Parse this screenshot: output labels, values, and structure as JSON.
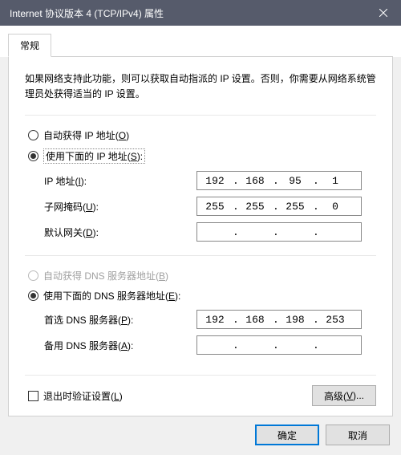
{
  "window": {
    "title": "Internet 协议版本 4 (TCP/IPv4) 属性"
  },
  "tab": {
    "general": "常规"
  },
  "description": "如果网络支持此功能，则可以获取自动指派的 IP 设置。否则，你需要从网络系统管理员处获得适当的 IP 设置。",
  "ip_group": {
    "auto_label": "自动获得 IP 地址(",
    "auto_key": "O",
    "auto_after": ")",
    "manual_label": "使用下面的 IP 地址(",
    "manual_key": "S",
    "manual_after": "):",
    "fields": {
      "ip": {
        "label": "IP 地址(",
        "key": "I",
        "after": "):",
        "octets": [
          "192",
          "168",
          "95",
          "1"
        ]
      },
      "mask": {
        "label": "子网掩码(",
        "key": "U",
        "after": "):",
        "octets": [
          "255",
          "255",
          "255",
          "0"
        ]
      },
      "gateway": {
        "label": "默认网关(",
        "key": "D",
        "after": "):",
        "octets": [
          "",
          "",
          "",
          ""
        ]
      }
    }
  },
  "dns_group": {
    "auto_label": "自动获得 DNS 服务器地址(",
    "auto_key": "B",
    "auto_after": ")",
    "manual_label": "使用下面的 DNS 服务器地址(",
    "manual_key": "E",
    "manual_after": "):",
    "fields": {
      "primary": {
        "label": "首选 DNS 服务器(",
        "key": "P",
        "after": "):",
        "octets": [
          "192",
          "168",
          "198",
          "253"
        ]
      },
      "alt": {
        "label": "备用 DNS 服务器(",
        "key": "A",
        "after": "):",
        "octets": [
          "",
          "",
          "",
          ""
        ]
      }
    }
  },
  "validate": {
    "label": "退出时验证设置(",
    "key": "L",
    "after": ")"
  },
  "buttons": {
    "advanced_label": "高级(",
    "advanced_key": "V",
    "advanced_after": ")...",
    "ok": "确定",
    "cancel": "取消"
  }
}
